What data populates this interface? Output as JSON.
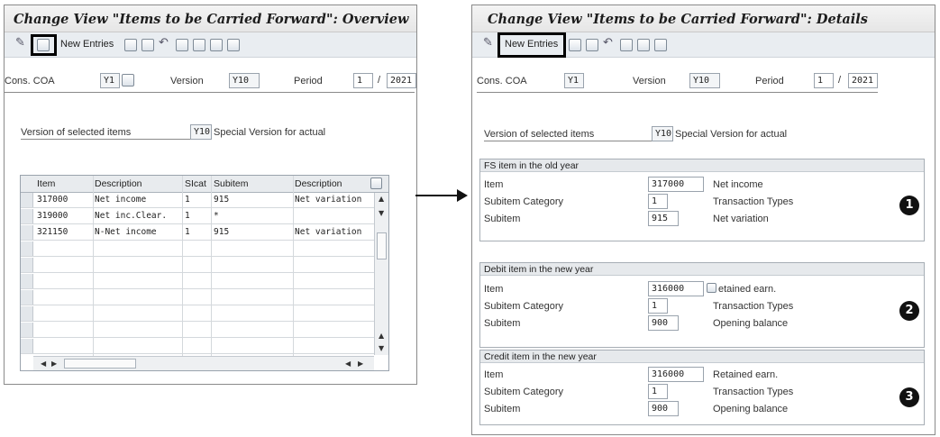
{
  "left": {
    "title": "Change View \"Items to be Carried Forward\": Overview",
    "toolbar": {
      "new_entries": "New Entries"
    },
    "header": {
      "cons_coa_label": "Cons. COA",
      "cons_coa_value": "Y1",
      "version_label": "Version",
      "version_value": "Y10",
      "period_label": "Period",
      "period_value": "1",
      "period_sep": "/",
      "year_value": "2021"
    },
    "version_sel": {
      "label": "Version of selected items",
      "value": "Y10",
      "text": "Special Version for actual"
    },
    "table": {
      "columns": [
        "Item",
        "Description",
        "SIcat",
        "Subitem",
        "Description"
      ],
      "rows": [
        [
          "317000",
          "Net income",
          "1",
          "915",
          "Net variation"
        ],
        [
          "319000",
          "Net inc.Clear.",
          "1",
          "*",
          ""
        ],
        [
          "321150",
          "N-Net income",
          "1",
          "915",
          "Net variation"
        ]
      ]
    }
  },
  "right": {
    "title": "Change View \"Items to be Carried Forward\": Details",
    "toolbar": {
      "new_entries": "New Entries"
    },
    "header": {
      "cons_coa_label": "Cons. COA",
      "cons_coa_value": "Y1",
      "version_label": "Version",
      "version_value": "Y10",
      "period_label": "Period",
      "period_value": "1",
      "period_sep": "/",
      "year_value": "2021"
    },
    "version_sel": {
      "label": "Version of selected items",
      "value": "Y10",
      "text": "Special Version for actual"
    },
    "groups": [
      {
        "title": "FS item in the old year",
        "badge": "1",
        "item_label": "Item",
        "item_value": "317000",
        "item_text": "Net income",
        "cat_label": "Subitem Category",
        "cat_value": "1",
        "cat_text": "Transaction Types",
        "sub_label": "Subitem",
        "sub_value": "915",
        "sub_text": "Net variation"
      },
      {
        "title": "Debit item in the new year",
        "badge": "2",
        "item_label": "Item",
        "item_value": "316000",
        "item_text": "etained earn.",
        "cat_label": "Subitem Category",
        "cat_value": "1",
        "cat_text": "Transaction Types",
        "sub_label": "Subitem",
        "sub_value": "900",
        "sub_text": "Opening balance"
      },
      {
        "title": "Credit item in the new year",
        "badge": "3",
        "item_label": "Item",
        "item_value": "316000",
        "item_text": "Retained earn.",
        "cat_label": "Subitem Category",
        "cat_value": "1",
        "cat_text": "Transaction Types",
        "sub_label": "Subitem",
        "sub_value": "900",
        "sub_text": "Opening balance"
      }
    ]
  }
}
